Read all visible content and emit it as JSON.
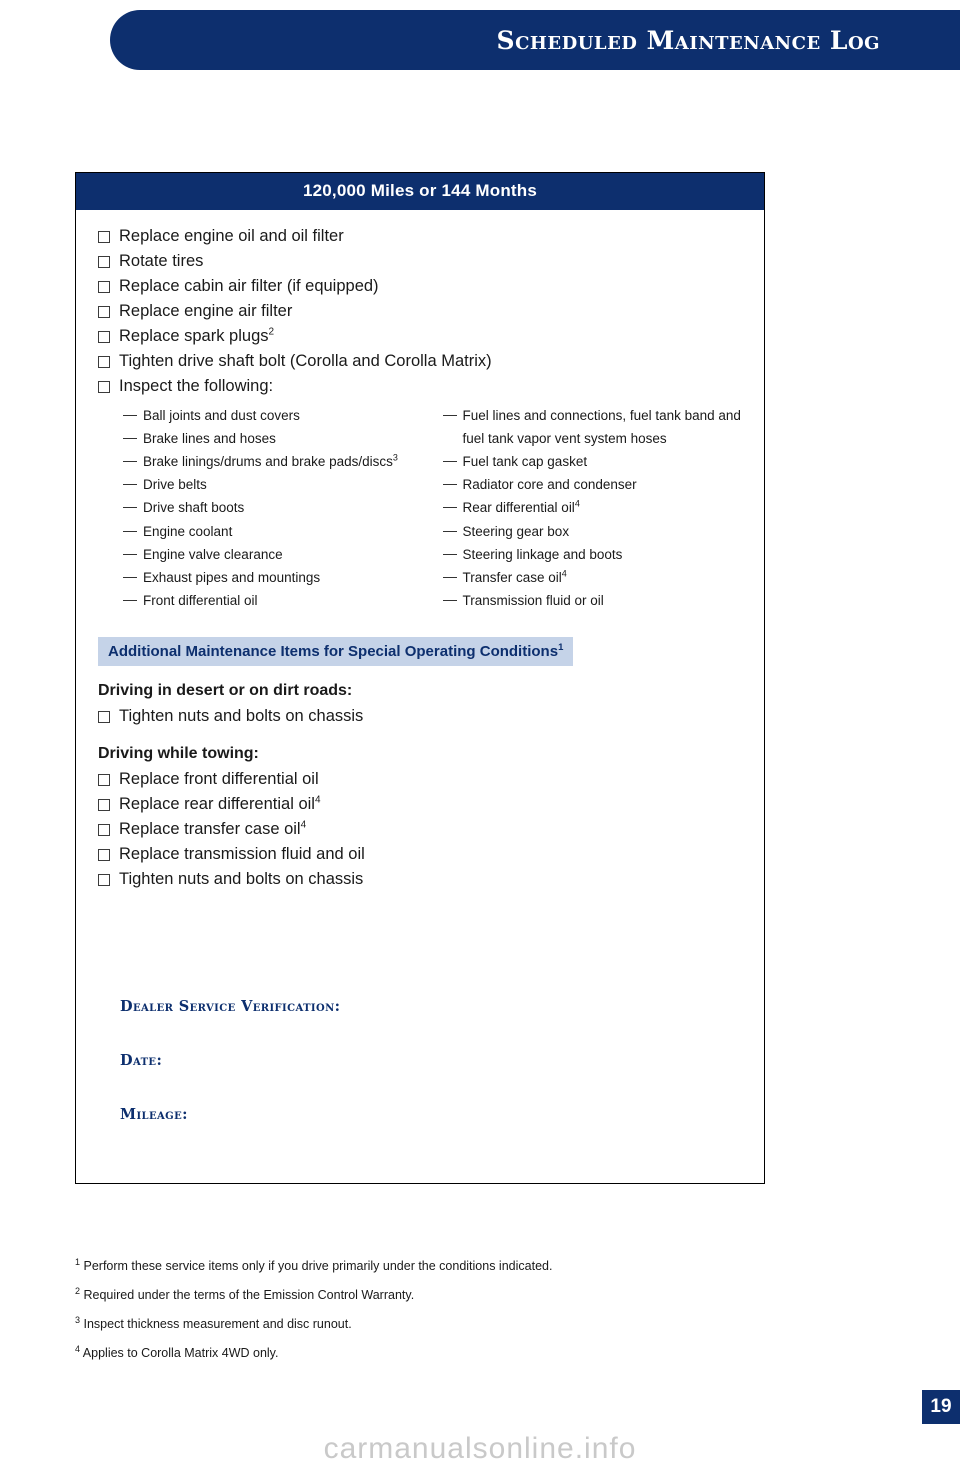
{
  "header": {
    "title": "Scheduled Maintenance Log"
  },
  "card": {
    "title": "120,000 Miles or 144 Months",
    "main_items": [
      {
        "text": "Replace engine oil and oil filter",
        "sup": ""
      },
      {
        "text": "Rotate tires",
        "sup": ""
      },
      {
        "text": "Replace cabin air filter (if equipped)",
        "sup": ""
      },
      {
        "text": "Replace engine air filter",
        "sup": ""
      },
      {
        "text": "Replace spark plugs",
        "sup": "2"
      },
      {
        "text": "Tighten drive shaft bolt (Corolla and Corolla Matrix)",
        "sup": ""
      },
      {
        "text": "Inspect the following:",
        "sup": ""
      }
    ],
    "inspect_left": [
      {
        "text": "Ball joints and dust covers",
        "sup": ""
      },
      {
        "text": "Brake lines and hoses",
        "sup": ""
      },
      {
        "text": "Brake linings/drums and brake pads/discs",
        "sup": "3"
      },
      {
        "text": "Drive belts",
        "sup": ""
      },
      {
        "text": "Drive shaft boots",
        "sup": ""
      },
      {
        "text": "Engine coolant",
        "sup": ""
      },
      {
        "text": "Engine valve clearance",
        "sup": ""
      },
      {
        "text": "Exhaust pipes and mountings",
        "sup": ""
      },
      {
        "text": "Front differential oil",
        "sup": ""
      }
    ],
    "inspect_right": [
      {
        "text": "Fuel lines and connections, fuel tank band and fuel tank vapor vent system hoses",
        "sup": ""
      },
      {
        "text": "Fuel tank cap gasket",
        "sup": ""
      },
      {
        "text": "Radiator core and condenser",
        "sup": ""
      },
      {
        "text": "Rear differential oil",
        "sup": "4"
      },
      {
        "text": "Steering gear box",
        "sup": ""
      },
      {
        "text": "Steering linkage and boots",
        "sup": ""
      },
      {
        "text": "Transfer case oil",
        "sup": "4"
      },
      {
        "text": "Transmission fluid or oil",
        "sup": ""
      }
    ],
    "special_bar": {
      "text": "Additional Maintenance Items for Special Operating Conditions",
      "sup": "1"
    },
    "subhead_desert": "Driving in desert or on dirt roads:",
    "desert_items": [
      {
        "text": "Tighten nuts and bolts on chassis",
        "sup": ""
      }
    ],
    "subhead_towing": "Driving while towing:",
    "towing_items": [
      {
        "text": "Replace front differential oil",
        "sup": ""
      },
      {
        "text": "Replace rear differential oil",
        "sup": "4"
      },
      {
        "text": "Replace transfer case oil",
        "sup": "4"
      },
      {
        "text": "Replace transmission fluid and oil",
        "sup": ""
      },
      {
        "text": "Tighten nuts and bolts on chassis",
        "sup": ""
      }
    ],
    "dealer_verification_label": "Dealer Service Verification:",
    "date_label": "Date:",
    "mileage_label": "Mileage:"
  },
  "footnotes": [
    {
      "marker": "1",
      "text": "Perform these service items only if you drive primarily under the conditions indicated."
    },
    {
      "marker": "2",
      "text": "Required under the terms of the Emission Control Warranty."
    },
    {
      "marker": "3",
      "text": "Inspect thickness measurement and disc runout."
    },
    {
      "marker": "4",
      "text": "Applies to Corolla Matrix 4WD only."
    }
  ],
  "page_number": "19",
  "watermark": "carmanualsonline.info",
  "colors": {
    "brand_blue": "#0d2f6e",
    "band_blue": "#c5d3e8"
  }
}
